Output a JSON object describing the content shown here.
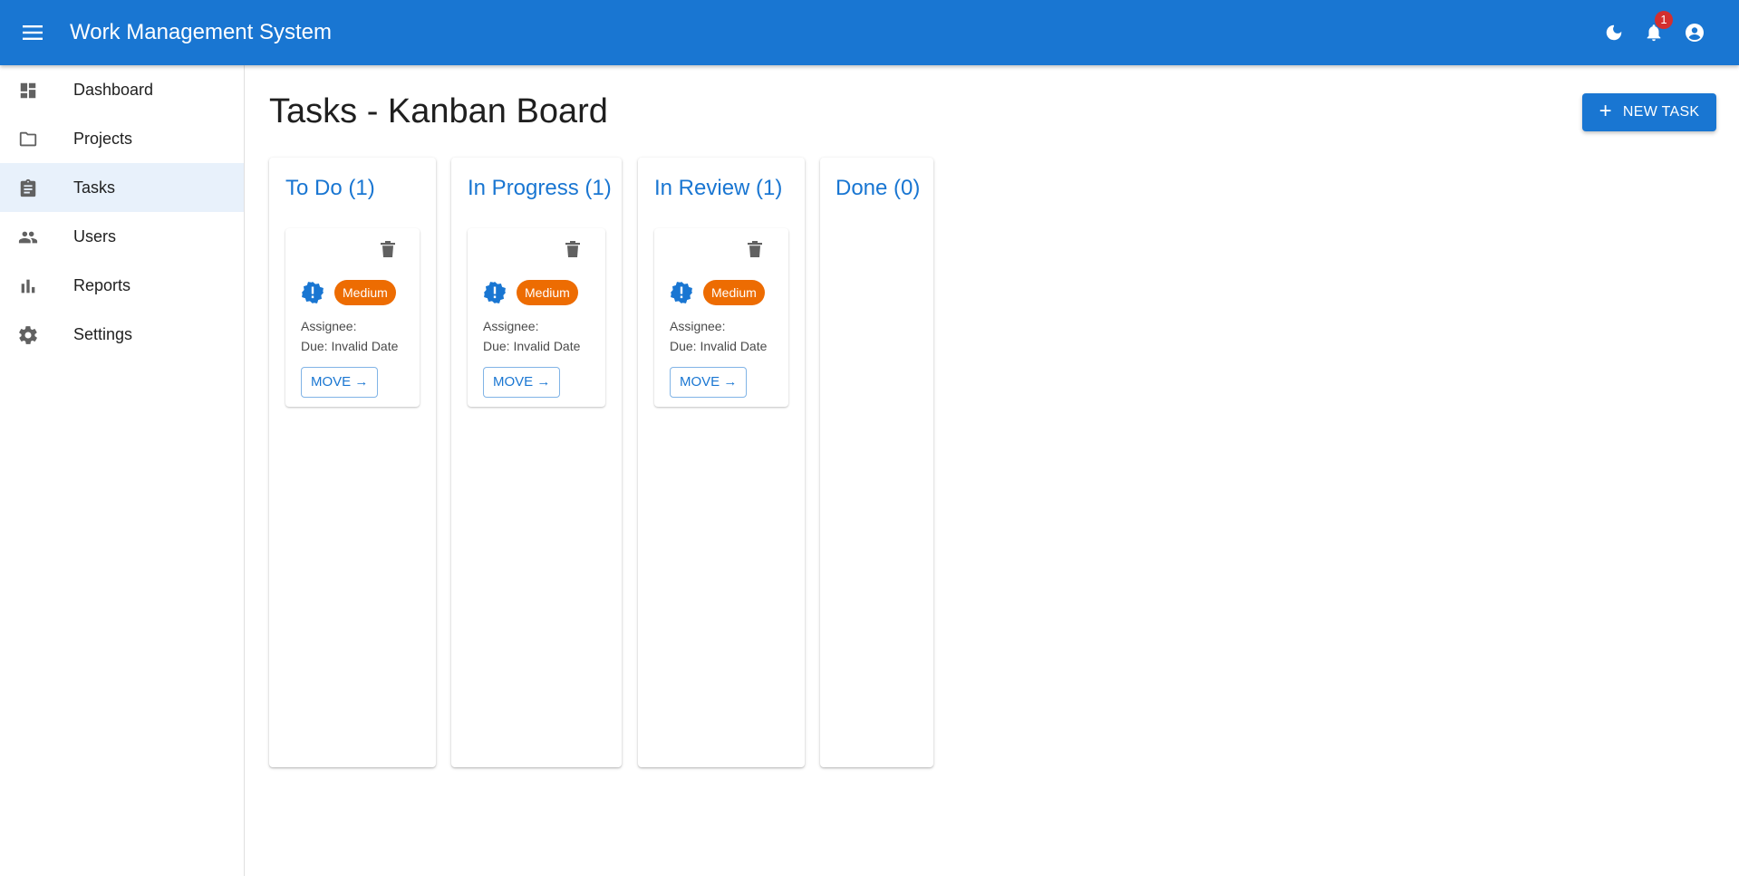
{
  "app": {
    "title": "Work Management System",
    "notification_count": "1"
  },
  "sidebar": {
    "items": [
      {
        "label": "Dashboard",
        "icon": "dashboard-icon"
      },
      {
        "label": "Projects",
        "icon": "folder-icon"
      },
      {
        "label": "Tasks",
        "icon": "clipboard-icon",
        "selected": true
      },
      {
        "label": "Users",
        "icon": "users-icon"
      },
      {
        "label": "Reports",
        "icon": "bar-chart-icon"
      },
      {
        "label": "Settings",
        "icon": "gear-icon"
      }
    ]
  },
  "main": {
    "title": "Tasks - Kanban Board",
    "new_task_label": "NEW TASK",
    "columns": [
      {
        "title": "To Do (1)",
        "card": {
          "priority": "Medium",
          "assignee": "Assignee:",
          "due": "Due: Invalid Date",
          "move_label": "MOVE →"
        }
      },
      {
        "title": "In Progress (1)",
        "card": {
          "priority": "Medium",
          "assignee": "Assignee:",
          "due": "Due: Invalid Date",
          "move_label": "MOVE →"
        }
      },
      {
        "title": "In Review (1)",
        "card": {
          "priority": "Medium",
          "assignee": "Assignee:",
          "due": "Due: Invalid Date",
          "move_label": "MOVE →"
        }
      },
      {
        "title": "Done (0)"
      }
    ]
  },
  "colors": {
    "primary": "#1976d2",
    "priority_medium": "#ed6c02",
    "badge": "#d32f2f",
    "selected_nav_bg": "#e8f1fb"
  }
}
